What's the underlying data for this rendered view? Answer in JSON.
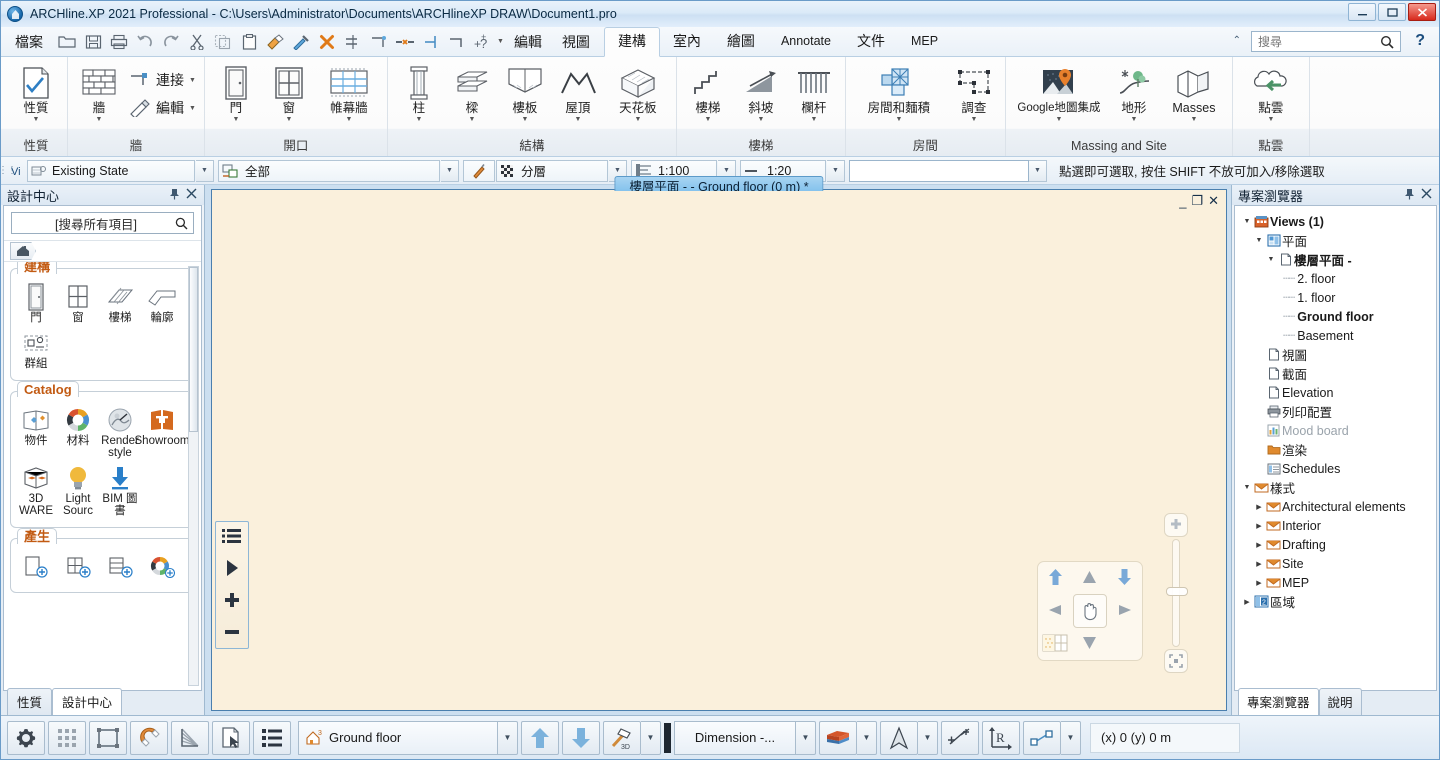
{
  "window": {
    "title": "ARCHline.XP 2021  Professional - C:\\Users\\Administrator\\Documents\\ARCHlineXP DRAW\\Document1.pro",
    "minimize": "—",
    "maximize": "❐",
    "close": "✕"
  },
  "menubar": {
    "file": "檔案",
    "edit": "編輯",
    "view": "視圖",
    "quick_access": [
      {
        "name": "open-icon",
        "glyph": "🗀"
      },
      {
        "name": "save-icon",
        "glyph": "🖫"
      },
      {
        "name": "print-icon",
        "glyph": "🖶"
      },
      {
        "name": "undo-icon",
        "glyph": "↶"
      },
      {
        "name": "redo-icon",
        "glyph": "↷"
      },
      {
        "name": "cut-icon",
        "glyph": "✂"
      },
      {
        "name": "copy-icon",
        "glyph": "❐"
      },
      {
        "name": "paste-icon",
        "glyph": "📋"
      },
      {
        "name": "paint-format-icon",
        "glyph": "🖌"
      },
      {
        "name": "eyedropper-icon",
        "glyph": "🖊"
      },
      {
        "name": "delete-icon",
        "glyph": "✖"
      },
      {
        "name": "trim-icon",
        "glyph": "⊣"
      },
      {
        "name": "extend-icon",
        "glyph": "⌐"
      },
      {
        "name": "break-icon",
        "glyph": "⎯"
      },
      {
        "name": "offset-icon",
        "glyph": "⊢"
      },
      {
        "name": "corner-icon",
        "glyph": "⌐"
      },
      {
        "name": "help-query-icon",
        "glyph": "?"
      }
    ]
  },
  "ribbon": {
    "tabs": [
      {
        "label": "建構",
        "active": true,
        "latin": false
      },
      {
        "label": "室內",
        "active": false,
        "latin": false
      },
      {
        "label": "繪圖",
        "active": false,
        "latin": false
      },
      {
        "label": "Annotate",
        "active": false,
        "latin": true
      },
      {
        "label": "文件",
        "active": false,
        "latin": false
      },
      {
        "label": "MEP",
        "active": false,
        "latin": true
      }
    ],
    "search_placeholder": "搜尋",
    "help_label": "?",
    "groups": [
      {
        "title": "性質",
        "buttons": [
          {
            "label": "性質",
            "icon": "properties-icon",
            "arrow": true
          }
        ]
      },
      {
        "title": "牆",
        "buttons": [
          {
            "label": "牆",
            "icon": "wall-icon",
            "arrow": true
          }
        ],
        "stack": [
          {
            "label": "連接",
            "icon": "wall-connect-icon",
            "arrow": true
          },
          {
            "label": "編輯",
            "icon": "wall-edit-icon",
            "arrow": true
          }
        ]
      },
      {
        "title": "開口",
        "buttons": [
          {
            "label": "門",
            "icon": "door-icon",
            "arrow": true
          },
          {
            "label": "窗",
            "icon": "window-icon",
            "arrow": true
          },
          {
            "label": "帷幕牆",
            "icon": "curtain-wall-icon",
            "arrow": true
          }
        ]
      },
      {
        "title": "結構",
        "buttons": [
          {
            "label": "柱",
            "icon": "column-icon",
            "arrow": true
          },
          {
            "label": "樑",
            "icon": "beam-icon",
            "arrow": true
          },
          {
            "label": "樓板",
            "icon": "slab-icon",
            "arrow": true
          },
          {
            "label": "屋頂",
            "icon": "roof-icon",
            "arrow": true
          },
          {
            "label": "天花板",
            "icon": "ceiling-icon",
            "arrow": true
          }
        ]
      },
      {
        "title": "樓梯",
        "buttons": [
          {
            "label": "樓梯",
            "icon": "stair-icon",
            "arrow": true
          },
          {
            "label": "斜坡",
            "icon": "ramp-icon",
            "arrow": true
          },
          {
            "label": "欄杆",
            "icon": "railing-icon",
            "arrow": true
          }
        ]
      },
      {
        "title": "房間",
        "buttons": [
          {
            "label": "房間和麵積",
            "icon": "room-and-area-icon",
            "arrow": true
          },
          {
            "label": "調查",
            "icon": "survey-icon",
            "arrow": true
          }
        ]
      },
      {
        "title": "Massing and Site",
        "buttons": [
          {
            "label": "Google地圖集成",
            "icon": "google-maps-icon",
            "arrow": true
          },
          {
            "label": "地形",
            "icon": "terrain-icon",
            "arrow": true
          },
          {
            "label": "Masses",
            "icon": "masses-icon",
            "arrow": true
          }
        ]
      },
      {
        "title": "點雲",
        "buttons": [
          {
            "label": "點雲",
            "icon": "point-cloud-icon",
            "arrow": true
          }
        ]
      }
    ]
  },
  "optionsbar": {
    "status_field": "Existing State",
    "layer_filter": "全部",
    "layer_group": "分層",
    "scale_plan": "1:100",
    "scale_detail": "1:20",
    "empty_combo": "",
    "hint": "點選即可選取, 按住 SHIFT 不放可加入/移除選取"
  },
  "designcenter": {
    "title": "設計中心",
    "pin": "📌",
    "close": "✕",
    "search_placeholder": "[搜尋所有項目]",
    "breadcrumb_home": "home-icon",
    "groups": [
      {
        "title": "建構",
        "items": [
          {
            "label": "門",
            "icon": "door-icon"
          },
          {
            "label": "窗",
            "icon": "window-icon"
          },
          {
            "label": "樓梯",
            "icon": "stair-icon"
          },
          {
            "label": "輪廓",
            "icon": "profile-icon"
          },
          {
            "label": "群組",
            "icon": "group-icon"
          }
        ]
      },
      {
        "title": "Catalog",
        "items": [
          {
            "label": "物件",
            "icon": "objects-icon"
          },
          {
            "label": "材料",
            "icon": "materials-icon"
          },
          {
            "label": "Render style",
            "icon": "render-style-icon"
          },
          {
            "label": "Showroom",
            "icon": "showroom-icon"
          },
          {
            "label": "3D WARE",
            "icon": "3dware-icon"
          },
          {
            "label": "Light Sourc",
            "icon": "light-source-icon"
          },
          {
            "label": "BIM 圖書",
            "icon": "bim-library-icon"
          }
        ]
      },
      {
        "title": "產生",
        "items": [
          {
            "label": "",
            "icon": "new-door-icon"
          },
          {
            "label": "",
            "icon": "new-window-icon"
          },
          {
            "label": "",
            "icon": "new-object-icon"
          },
          {
            "label": "",
            "icon": "new-material-icon"
          }
        ]
      }
    ],
    "tabs": [
      {
        "label": "性質",
        "active": false
      },
      {
        "label": "設計中心",
        "active": true
      }
    ]
  },
  "canvas": {
    "doc_title": "樓層平面 -  - Ground floor (0 m) *",
    "win_minimize": "_",
    "win_restore": "❐",
    "win_close": "✕",
    "side_tools": [
      {
        "name": "list-icon",
        "glyph": "☰"
      },
      {
        "name": "play-cursor-icon",
        "glyph": "▶"
      },
      {
        "name": "plus-icon",
        "glyph": "✚"
      },
      {
        "name": "minus-icon",
        "glyph": "▬"
      }
    ],
    "navwheel": {
      "up_blue": "⬆",
      "up_grey": "▲",
      "down_blue": "⬇",
      "left": "◀",
      "hand": "✋",
      "right": "▶",
      "grid": "grid-icon",
      "down_grey": "▼"
    },
    "zoom": {
      "plus": "✚",
      "fit": "⛶"
    }
  },
  "navigator": {
    "title": "專案瀏覽器",
    "pin": "📌",
    "close": "✕",
    "tree": [
      {
        "depth": 0,
        "label": "Views (1)",
        "icon": "views-icon",
        "twisty": "▼",
        "bold": true,
        "dim": false,
        "dash": false
      },
      {
        "depth": 1,
        "label": "平面",
        "icon": "plan-icon",
        "twisty": "▼",
        "bold": false,
        "dim": false,
        "dash": false
      },
      {
        "depth": 2,
        "label": "樓層平面 -",
        "icon": "page-icon",
        "twisty": "▼",
        "bold": true,
        "dim": false,
        "dash": false
      },
      {
        "depth": 3,
        "label": "2. floor",
        "icon": "",
        "twisty": "",
        "bold": false,
        "dim": false,
        "dash": true
      },
      {
        "depth": 3,
        "label": "1. floor",
        "icon": "",
        "twisty": "",
        "bold": false,
        "dim": false,
        "dash": true
      },
      {
        "depth": 3,
        "label": "Ground floor",
        "icon": "",
        "twisty": "",
        "bold": true,
        "dim": false,
        "dash": true
      },
      {
        "depth": 3,
        "label": "Basement",
        "icon": "",
        "twisty": "",
        "bold": false,
        "dim": false,
        "dash": true
      },
      {
        "depth": 2,
        "label": "視圖",
        "icon": "page-icon",
        "twisty": "",
        "bold": false,
        "dim": false,
        "dash": false
      },
      {
        "depth": 2,
        "label": "截面",
        "icon": "page-icon",
        "twisty": "",
        "bold": false,
        "dim": false,
        "dash": false
      },
      {
        "depth": 2,
        "label": "Elevation",
        "icon": "page-icon",
        "twisty": "",
        "bold": false,
        "dim": false,
        "dash": false
      },
      {
        "depth": 2,
        "label": "列印配置",
        "icon": "print-layout-icon",
        "twisty": "",
        "bold": false,
        "dim": false,
        "dash": false
      },
      {
        "depth": 2,
        "label": "Mood board",
        "icon": "mood-board-icon",
        "twisty": "",
        "bold": false,
        "dim": true,
        "dash": false
      },
      {
        "depth": 2,
        "label": "渲染",
        "icon": "folder-icon",
        "twisty": "",
        "bold": false,
        "dim": false,
        "dash": false
      },
      {
        "depth": 2,
        "label": "Schedules",
        "icon": "schedules-icon",
        "twisty": "",
        "bold": false,
        "dim": false,
        "dash": false
      },
      {
        "depth": 0,
        "label": "樣式",
        "icon": "styles-icon",
        "twisty": "▼",
        "bold": false,
        "dim": false,
        "dash": false
      },
      {
        "depth": 1,
        "label": "Architectural elements",
        "icon": "styles-icon",
        "twisty": "▶",
        "bold": false,
        "dim": false,
        "dash": false
      },
      {
        "depth": 1,
        "label": "Interior",
        "icon": "styles-icon",
        "twisty": "▶",
        "bold": false,
        "dim": false,
        "dash": false
      },
      {
        "depth": 1,
        "label": "Drafting",
        "icon": "styles-icon",
        "twisty": "▶",
        "bold": false,
        "dim": false,
        "dash": false
      },
      {
        "depth": 1,
        "label": "Site",
        "icon": "styles-icon",
        "twisty": "▶",
        "bold": false,
        "dim": false,
        "dash": false
      },
      {
        "depth": 1,
        "label": "MEP",
        "icon": "styles-icon",
        "twisty": "▶",
        "bold": false,
        "dim": false,
        "dash": false
      },
      {
        "depth": 0,
        "label": "區域",
        "icon": "zone-icon",
        "twisty": "▶",
        "bold": false,
        "dim": false,
        "dash": false
      }
    ],
    "tabs": [
      {
        "label": "專案瀏覽器",
        "active": true
      },
      {
        "label": "說明",
        "active": false
      }
    ]
  },
  "statusbar": {
    "buttons": [
      {
        "name": "settings-gear-button",
        "icon": "gear-icon"
      },
      {
        "name": "grid-button",
        "icon": "grid-icon"
      },
      {
        "name": "boundary-button",
        "icon": "boundary-icon"
      },
      {
        "name": "snap-magnet-button",
        "icon": "magnet-icon"
      },
      {
        "name": "angle-snap-button",
        "icon": "angle-snap-icon"
      },
      {
        "name": "pick-button",
        "icon": "pick-cursor-icon"
      },
      {
        "name": "layer-list-button",
        "icon": "layer-list-icon"
      }
    ],
    "floor_combo": "Ground floor",
    "floor_icon": "floor-icon",
    "up_arrow": "⬆",
    "down_arrow": "⬇",
    "hammer_3d_icon": "hammer-3d-icon",
    "dimension_combo": "Dimension -...",
    "brick_icon": "material-brick-icon",
    "north_icon": "north-arrow-icon",
    "point_icon": "point-snap-icon",
    "ucs_icon": "ucs-r-icon",
    "line_icon": "polyline-icon",
    "coordinates": "(x) 0    (y) 0 m"
  }
}
